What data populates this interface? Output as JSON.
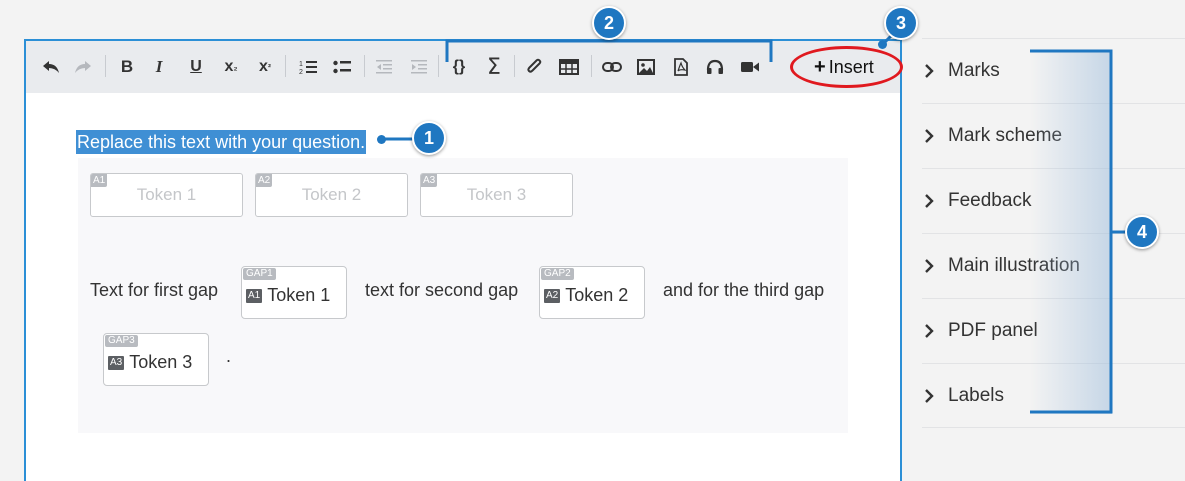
{
  "toolbar": {
    "buttons": [
      {
        "name": "undo-icon",
        "glyph": "↶"
      },
      {
        "name": "redo-icon",
        "glyph": "↷"
      },
      {
        "name": "bold-icon",
        "glyph": "B"
      },
      {
        "name": "italic-icon",
        "glyph": "I"
      },
      {
        "name": "underline-icon",
        "glyph": "U"
      },
      {
        "name": "subscript-icon",
        "glyph": "x₂"
      },
      {
        "name": "superscript-icon",
        "glyph": "x²"
      },
      {
        "name": "numbered-list-icon",
        "glyph": "1≡"
      },
      {
        "name": "bullet-list-icon",
        "glyph": "•≡"
      },
      {
        "name": "outdent-icon",
        "glyph": "⇤"
      },
      {
        "name": "indent-icon",
        "glyph": "⇥"
      },
      {
        "name": "braces-icon",
        "glyph": "{}"
      },
      {
        "name": "sigma-icon",
        "glyph": "Σ"
      },
      {
        "name": "paperclip-icon",
        "glyph": "📎"
      },
      {
        "name": "table-icon",
        "glyph": "▦"
      },
      {
        "name": "link-icon",
        "glyph": "⚯"
      },
      {
        "name": "image-icon",
        "glyph": "🖼"
      },
      {
        "name": "pdf-icon",
        "glyph": "pdf"
      },
      {
        "name": "headphones-icon",
        "glyph": "🎧"
      },
      {
        "name": "video-icon",
        "glyph": "■▶"
      }
    ],
    "insert_label": "Insert",
    "insert_plus": "+"
  },
  "editor": {
    "question_text": "Replace this text with your question.",
    "tokens": [
      {
        "tag": "A1",
        "label": "Token 1"
      },
      {
        "tag": "A2",
        "label": "Token 2"
      },
      {
        "tag": "A3",
        "label": "Token 3"
      }
    ],
    "sentence": {
      "part1": "Text for first gap",
      "part2": "text for second gap",
      "part3": "and for the third gap",
      "end": "."
    },
    "gaps": [
      {
        "tag": "GAP1",
        "token_tag": "A1",
        "token_label": "Token 1"
      },
      {
        "tag": "GAP2",
        "token_tag": "A2",
        "token_label": "Token 2"
      },
      {
        "tag": "GAP3",
        "token_tag": "A3",
        "token_label": "Token 3"
      }
    ]
  },
  "sidebar": {
    "items": [
      {
        "label": "Marks"
      },
      {
        "label": "Mark scheme"
      },
      {
        "label": "Feedback"
      },
      {
        "label": "Main illustration"
      },
      {
        "label": "PDF panel"
      },
      {
        "label": "Labels"
      }
    ]
  },
  "callouts": {
    "c1": "1",
    "c2": "2",
    "c3": "3",
    "c4": "4"
  },
  "colors": {
    "accent": "#2b8fd6",
    "callout": "#1f77c1",
    "highlight": "#3f8fd4",
    "insert_ring": "#e0191f"
  }
}
